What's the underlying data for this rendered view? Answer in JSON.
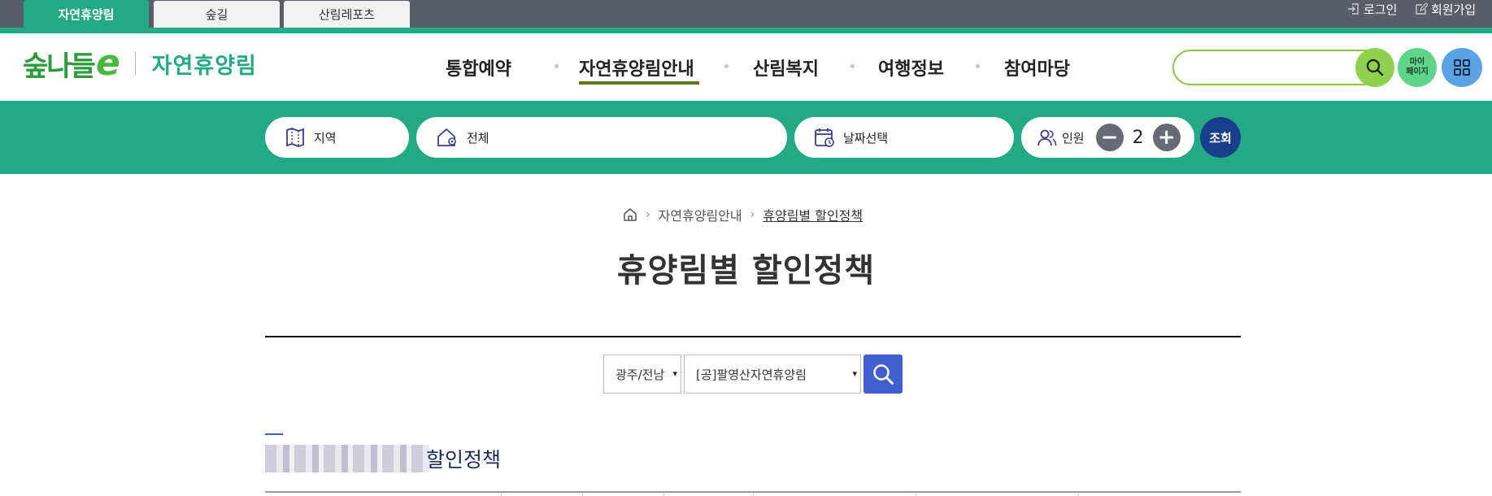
{
  "site_tabs": [
    {
      "label": "자연휴양림",
      "active": true
    },
    {
      "label": "숲길",
      "active": false
    },
    {
      "label": "산림레포츠",
      "active": false
    }
  ],
  "util_links": {
    "login": "로그인",
    "signup": "회원가입"
  },
  "logo": {
    "mark": "숲나들",
    "e": "e",
    "subtitle": "자연휴양림"
  },
  "gnb": [
    "통합예약",
    "자연휴양림안내",
    "산림복지",
    "여행정보",
    "참여마당"
  ],
  "gnb_active": "자연휴양림안내",
  "header": {
    "mypage_label_1": "마이",
    "mypage_label_2": "페이지"
  },
  "reservation": {
    "region_label": "지역",
    "facility_label": "전체",
    "date_label": "날짜선택",
    "people_label": "인원",
    "people_count": "2",
    "minus": "−",
    "plus": "+",
    "query_label": "조회"
  },
  "breadcrumb": {
    "level1": "자연휴양림안내",
    "level2": "휴양림별 할인정책"
  },
  "page_title": "휴양림별 할인정책",
  "filter": {
    "region_selected": "광주/전남",
    "forest_selected": "[공]팔영산자연휴양림"
  },
  "section": {
    "title": "할인정책"
  },
  "colors": {
    "brand_green": "#23a983",
    "nav_underline": "#5b7b16",
    "search_blue": "#3f5fd1",
    "query_navy": "#173f8c"
  }
}
